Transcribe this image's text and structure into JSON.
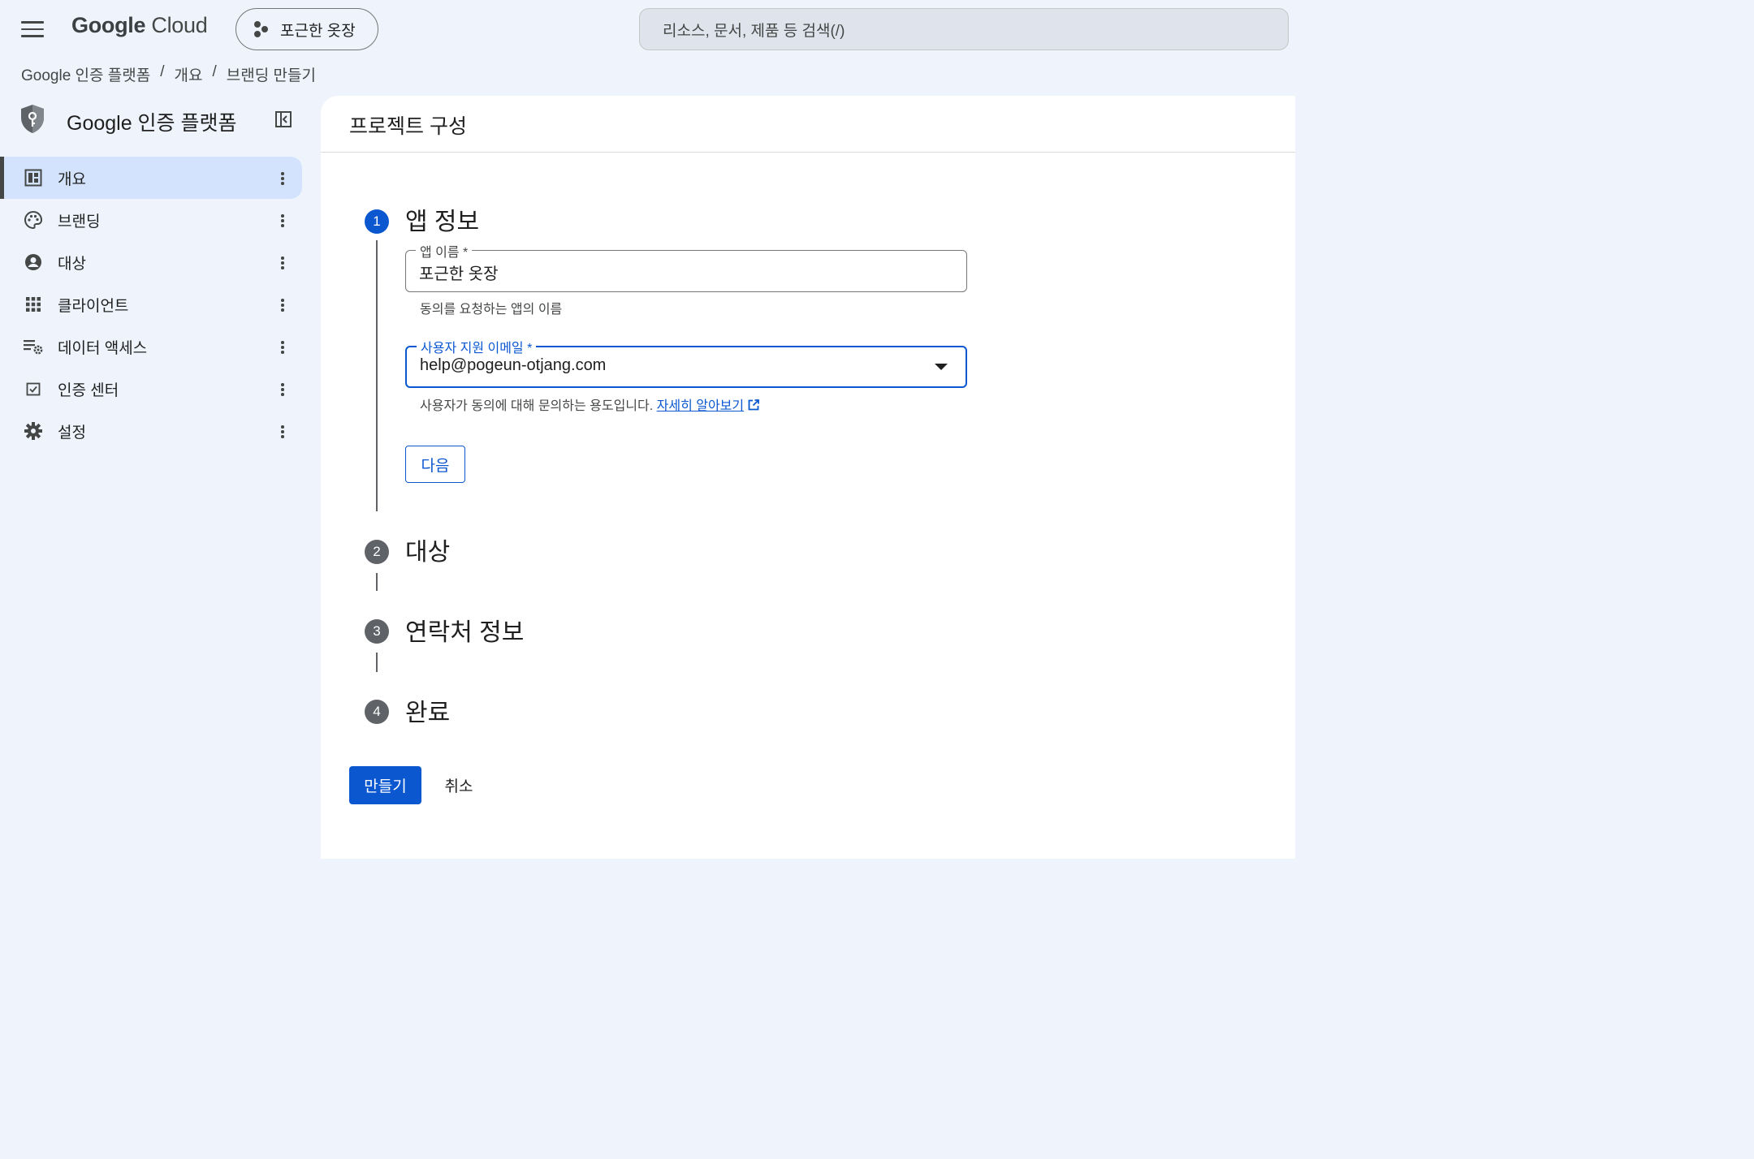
{
  "topbar": {
    "logo_main": "Google",
    "logo_suffix": "Cloud",
    "project": "포근한 옷장",
    "search_placeholder": "리소스, 문서, 제품 등 검색(/)"
  },
  "breadcrumb": [
    "Google 인증 플랫폼",
    "개요",
    "브랜딩 만들기"
  ],
  "sidebar": {
    "title": "Google 인증 플랫폼",
    "items": [
      {
        "label": "개요",
        "icon": "dashboard-icon",
        "active": true
      },
      {
        "label": "브랜딩",
        "icon": "palette-icon",
        "active": false
      },
      {
        "label": "대상",
        "icon": "account-circle-icon",
        "active": false
      },
      {
        "label": "클라이언트",
        "icon": "apps-grid-icon",
        "active": false
      },
      {
        "label": "데이터 액세스",
        "icon": "data-settings-icon",
        "active": false
      },
      {
        "label": "인증 센터",
        "icon": "verified-checkbox-icon",
        "active": false
      },
      {
        "label": "설정",
        "icon": "gear-icon",
        "active": false
      }
    ]
  },
  "main": {
    "title": "프로젝트 구성",
    "steps": [
      {
        "number": "1",
        "title": "앱 정보",
        "active": true
      },
      {
        "number": "2",
        "title": "대상",
        "active": false
      },
      {
        "number": "3",
        "title": "연락처 정보",
        "active": false
      },
      {
        "number": "4",
        "title": "완료",
        "active": false
      }
    ],
    "app_name": {
      "label": "앱 이름 *",
      "value": "포근한 옷장",
      "helper": "동의를 요청하는 앱의 이름"
    },
    "support_email": {
      "label": "사용자 지원 이메일 *",
      "value": "help@pogeun-otjang.com",
      "helper": "사용자가 동의에 대해 문의하는 용도입니다.",
      "link": "자세히 알아보기"
    },
    "next_button": "다음",
    "create_button": "만들기",
    "cancel_button": "취소"
  },
  "colors": {
    "accent": "#0b57d0",
    "background": "#eef3fc",
    "active_nav": "#d3e3fd"
  }
}
